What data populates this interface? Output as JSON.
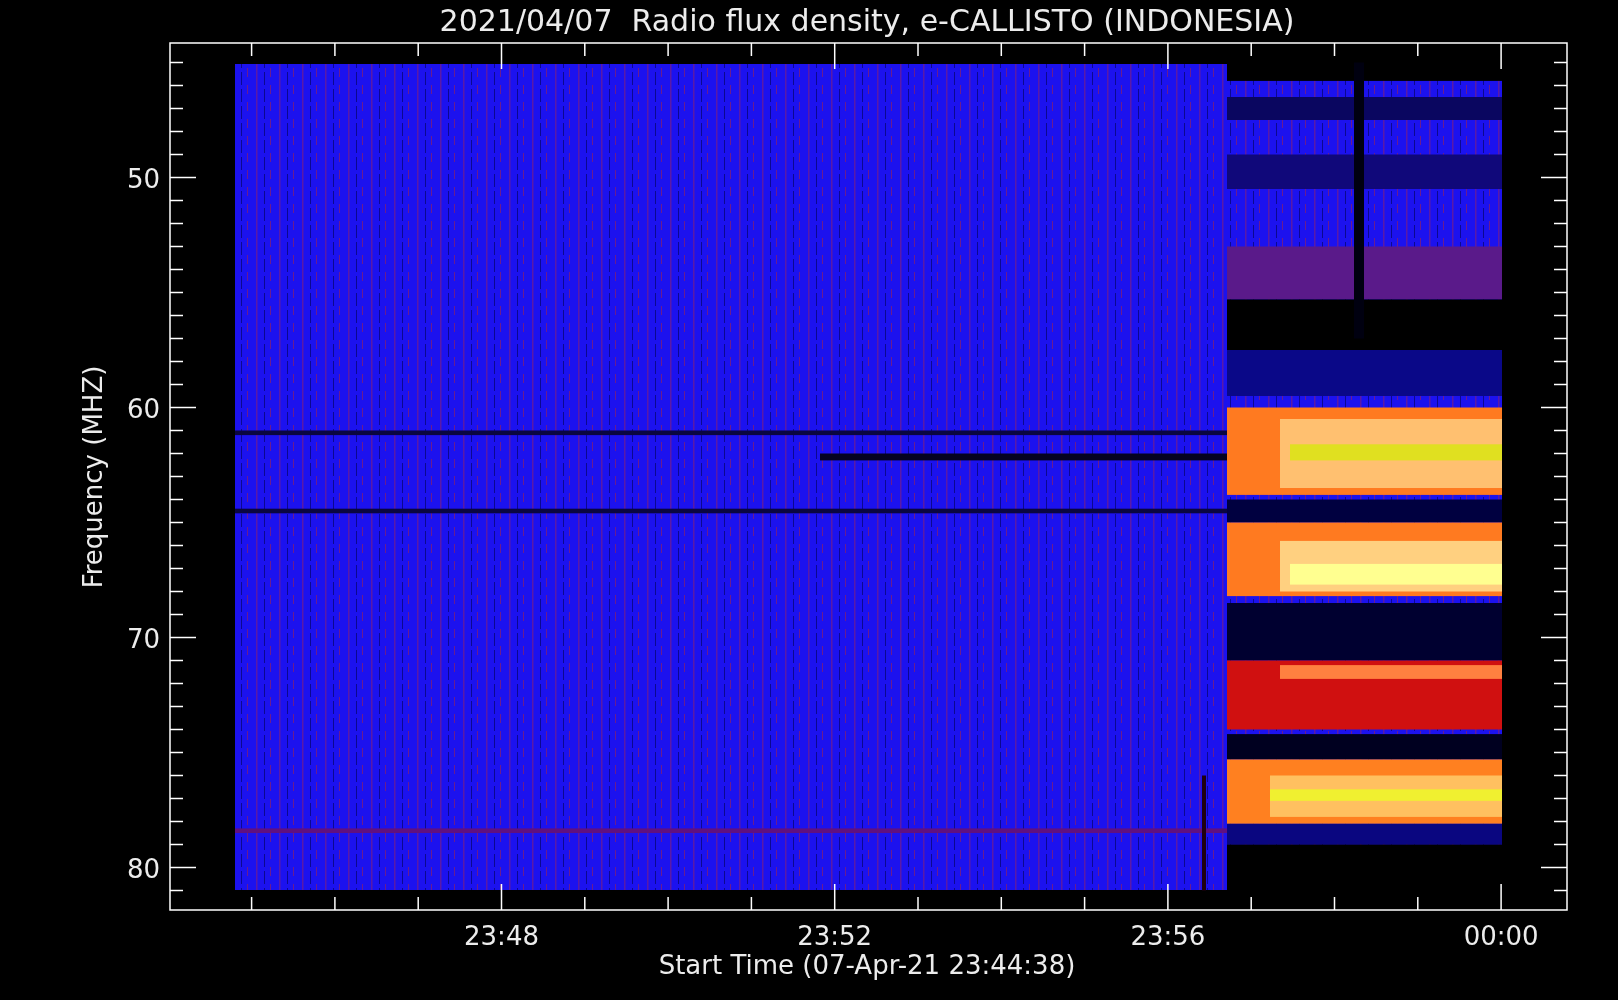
{
  "title": "2021/04/07  Radio flux density, e-CALLISTO (INDONESIA)",
  "plot": {
    "ylabel": "Frequency (MHZ)",
    "xlabel": "Start Time (07-Apr-21 23:44:38)",
    "yticks": [
      "50",
      "60",
      "70",
      "80"
    ],
    "xticks": [
      "23:48",
      "23:52",
      "23:56",
      "00:00"
    ]
  }
}
